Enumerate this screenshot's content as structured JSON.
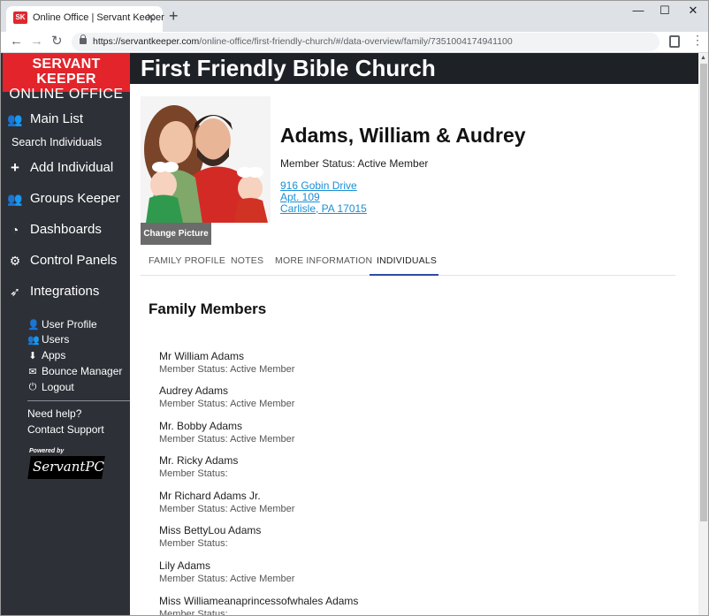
{
  "browser": {
    "tab_title": "Online Office | Servant Keeper",
    "favicon_text": "SK",
    "url_host": "https://servantkeeper.com",
    "url_path": "/online-office/first-friendly-church/#/data-overview/family/7351004174941100",
    "icons": [
      "back-icon",
      "forward-icon",
      "reload-icon",
      "lock-icon",
      "profile-icon",
      "menu-icon",
      "minimize-icon",
      "maximize-icon",
      "close-icon"
    ]
  },
  "brand": {
    "line1": "SERVANT KEEPER",
    "line2": "ONLINE OFFICE",
    "color": "#e3242b"
  },
  "sidebar": {
    "main_list": "Main List",
    "search_individuals": "Search Individuals",
    "add_individual": "Add Individual",
    "groups_keeper": "Groups Keeper",
    "dashboards": "Dashboards",
    "control_panels": "Control Panels",
    "integrations": "Integrations",
    "user_profile": "User Profile",
    "users": "Users",
    "apps": "Apps",
    "bounce_manager": "Bounce Manager",
    "logout": "Logout",
    "need_help": "Need help?",
    "contact_support": "Contact Support",
    "powered_by": "Powered by",
    "servantpc": "ServantPC",
    "background": "#2d3037"
  },
  "header": {
    "church_name": "First Friendly Bible Church",
    "background": "#1e2227"
  },
  "family": {
    "name": "Adams, William & Audrey",
    "status": "Member Status: Active Member",
    "change_picture": "Change Picture",
    "address": {
      "line1": "916 Gobin Drive",
      "line2": "Apt. 109",
      "line3": "Carlisle, PA 17015"
    }
  },
  "tabs": [
    {
      "label": "FAMILY PROFILE"
    },
    {
      "label": "NOTES"
    },
    {
      "label": "MORE INFORMATION"
    },
    {
      "label": "INDIVIDUALS",
      "active": true
    }
  ],
  "section_title": "Family Members",
  "members": [
    {
      "name": "Mr William Adams",
      "status": "Member Status: Active Member"
    },
    {
      "name": "Audrey Adams",
      "status": "Member Status: Active Member"
    },
    {
      "name": "Mr. Bobby Adams",
      "status": "Member Status: Active Member"
    },
    {
      "name": "Mr. Ricky Adams",
      "status": "Member Status:"
    },
    {
      "name": "Mr Richard Adams Jr.",
      "status": "Member Status: Active Member"
    },
    {
      "name": "Miss BettyLou Adams",
      "status": "Member Status:"
    },
    {
      "name": "Lily Adams",
      "status": "Member Status: Active Member"
    },
    {
      "name": "Miss Williameanaprincessofwhales Adams",
      "status": "Member Status:"
    }
  ],
  "colors": {
    "link": "#1a8fd6",
    "tab_underline": "#2f4aa6"
  }
}
